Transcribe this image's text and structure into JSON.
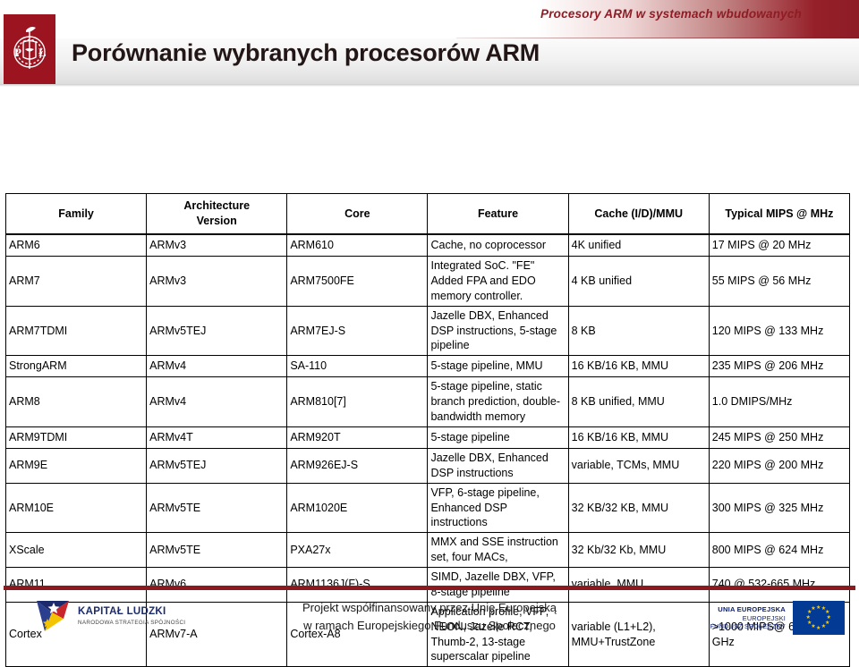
{
  "header": {
    "subtitle": "Procesory ARM w systemach wbudowanych",
    "title": "Porównanie wybranych procesorów ARM",
    "logo_name": "politechnika-lodzka-crest",
    "accent_color": "#8f1c24",
    "logo_bg_color": "#9b1420"
  },
  "table": {
    "columns": [
      {
        "key": "family",
        "label": "Family"
      },
      {
        "key": "arch",
        "label_line1": "Architecture",
        "label_line2": "Version"
      },
      {
        "key": "core",
        "label": "Core"
      },
      {
        "key": "feature",
        "label": "Feature"
      },
      {
        "key": "cache",
        "label": "Cache (I/D)/MMU"
      },
      {
        "key": "mips",
        "label": "Typical MIPS @ MHz"
      }
    ],
    "rows": [
      {
        "family": "ARM6",
        "arch": "ARMv3",
        "core": "ARM610",
        "feature": "Cache, no coprocessor",
        "cache": "4K unified",
        "mips": "17 MIPS @ 20 MHz"
      },
      {
        "family": "ARM7",
        "arch": "ARMv3",
        "core": "ARM7500FE",
        "feature": "Integrated SoC. \"FE\" Added FPA and EDO memory controller.",
        "cache": "4 KB unified",
        "mips": "55 MIPS @ 56 MHz"
      },
      {
        "family": "ARM7TDMI",
        "arch": "ARMv5TEJ",
        "core": "ARM7EJ-S",
        "feature": "Jazelle DBX, Enhanced DSP instructions, 5-stage pipeline",
        "cache": "8 KB",
        "mips": "120 MIPS @ 133 MHz"
      },
      {
        "family": "StrongARM",
        "arch": "ARMv4",
        "core": "SA-110",
        "feature": "5-stage pipeline, MMU",
        "cache": "16 KB/16 KB, MMU",
        "mips": "235 MIPS @ 206 MHz"
      },
      {
        "family": "ARM8",
        "arch": "ARMv4",
        "core": "ARM810[7]",
        "feature": "5-stage pipeline, static branch prediction, double-bandwidth memory",
        "cache": "8 KB unified, MMU",
        "mips": "1.0 DMIPS/MHz",
        "tall": true
      },
      {
        "family": "ARM9TDMI",
        "arch": "ARMv4T",
        "core": "ARM920T",
        "feature": "5-stage pipeline",
        "cache": "16 KB/16 KB, MMU",
        "mips": "245 MIPS @ 250 MHz"
      },
      {
        "family": "ARM9E",
        "arch": "ARMv5TEJ",
        "core": "ARM926EJ-S",
        "feature": "Jazelle DBX, Enhanced DSP instructions",
        "cache": "variable, TCMs, MMU",
        "mips": "220 MIPS @ 200 MHz"
      },
      {
        "family": "ARM10E",
        "arch": "ARMv5TE",
        "core": "ARM1020E",
        "feature": "VFP, 6-stage pipeline, Enhanced DSP instructions",
        "cache": "32 KB/32 KB, MMU",
        "mips": "300 MIPS @ 325 MHz"
      },
      {
        "family": "XScale",
        "arch": "ARMv5TE",
        "core": "PXA27x",
        "feature": "MMX and SSE instruction set, four MACs,",
        "cache": "32 Kb/32 Kb, MMU",
        "mips": "800 MIPS @ 624 MHz"
      },
      {
        "family": "ARM11",
        "arch": "ARMv6",
        "core": "ARM1136J(F)-S",
        "feature": "SIMD, Jazelle DBX, VFP, 8-stage pipeline",
        "cache": "variable, MMU",
        "mips": "740 @ 532-665 MHz"
      },
      {
        "family": "Cortex",
        "arch": "ARMv7-A",
        "core": "Cortex-A8",
        "feature": "Application profile, VFP, NEON, Jazelle RCT, Thumb-2, 13-stage superscalar pipeline",
        "cache": "variable (L1+L2), MMU+TrustZone",
        "mips": ">1000 MIPS@ 600 M-1 GHz",
        "tall": true,
        "mips_center": true
      }
    ]
  },
  "footer": {
    "rule_color": "#8a1a1e",
    "left_logo": {
      "name": "kapital-ludzki-logo",
      "title": "KAPITAŁ LUDZKI",
      "subtitle": "NARODOWA STRATEGIA SPÓJNOŚCI"
    },
    "center_line1": "Projekt współfinansowany przez Unię Europejską",
    "center_line2": "w ramach Europejskiego Funduszu Społecznego",
    "right_logo": {
      "name": "european-union-flag",
      "line1": "UNIA EUROPEJSKA",
      "line2": "EUROPEJSKI",
      "line3": "FUNDUSZ SPOŁECZNY",
      "flag_color": "#033b94",
      "star_color": "#ffcc00"
    }
  }
}
